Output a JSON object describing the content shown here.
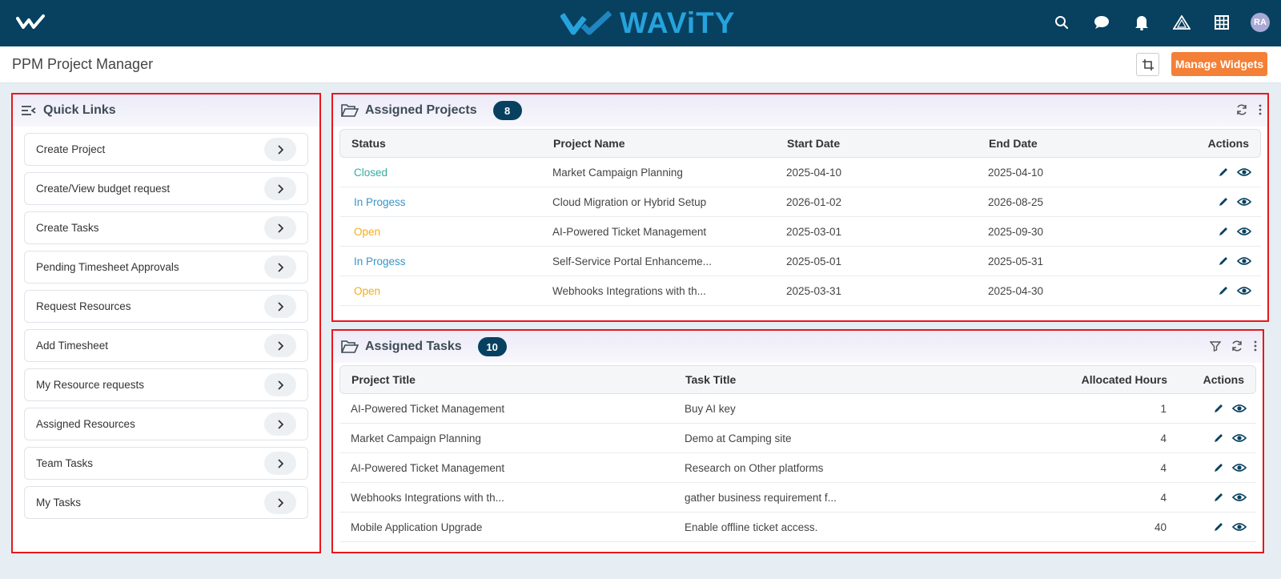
{
  "brand": {
    "name": "WAViTY",
    "accent": "#26a3dd",
    "nav_bg": "#07415f"
  },
  "nav": {
    "icons": [
      "search-icon",
      "chat-icon",
      "bell-icon",
      "triangle-icon",
      "grid-icon"
    ],
    "avatar_initials": "RA"
  },
  "page": {
    "title": "PPM Project Manager",
    "manage_widgets_label": "Manage Widgets"
  },
  "quick_links": {
    "title": "Quick Links",
    "items": [
      {
        "label": "Create Project"
      },
      {
        "label": "Create/View budget request"
      },
      {
        "label": "Create Tasks"
      },
      {
        "label": "Pending Timesheet Approvals"
      },
      {
        "label": "Request Resources"
      },
      {
        "label": "Add Timesheet"
      },
      {
        "label": "My Resource requests"
      },
      {
        "label": "Assigned Resources"
      },
      {
        "label": "Team Tasks"
      },
      {
        "label": "My Tasks"
      }
    ]
  },
  "assigned_projects": {
    "title": "Assigned Projects",
    "count": "8",
    "columns": [
      "Status",
      "Project Name",
      "Start Date",
      "End Date",
      "Actions"
    ],
    "rows": [
      {
        "status": "Closed",
        "status_kind": "closed",
        "name": "Market Campaign Planning",
        "start": "2025-04-10",
        "end": "2025-04-10"
      },
      {
        "status": "In Progess",
        "status_kind": "progress",
        "name": "Cloud Migration or Hybrid Setup",
        "start": "2026-01-02",
        "end": "2026-08-25"
      },
      {
        "status": "Open",
        "status_kind": "open",
        "name": "AI-Powered Ticket Management",
        "start": "2025-03-01",
        "end": "2025-09-30"
      },
      {
        "status": "In Progess",
        "status_kind": "progress",
        "name": "Self-Service Portal Enhanceme...",
        "start": "2025-05-01",
        "end": "2025-05-31"
      },
      {
        "status": "Open",
        "status_kind": "open",
        "name": "Webhooks Integrations with th...",
        "start": "2025-03-31",
        "end": "2025-04-30"
      }
    ]
  },
  "assigned_tasks": {
    "title": "Assigned Tasks",
    "count": "10",
    "columns": [
      "Project Title",
      "Task Title",
      "Allocated Hours",
      "Actions"
    ],
    "rows": [
      {
        "project": "AI-Powered Ticket Management",
        "task": "Buy AI key",
        "hours": "1"
      },
      {
        "project": "Market Campaign Planning",
        "task": "Demo at Camping site",
        "hours": "4"
      },
      {
        "project": "AI-Powered Ticket Management",
        "task": "Research on Other platforms",
        "hours": "4"
      },
      {
        "project": "Webhooks Integrations with th...",
        "task": "gather business requirement f...",
        "hours": "4"
      },
      {
        "project": "Mobile Application Upgrade",
        "task": "Enable offline ticket access.",
        "hours": "40"
      }
    ]
  }
}
